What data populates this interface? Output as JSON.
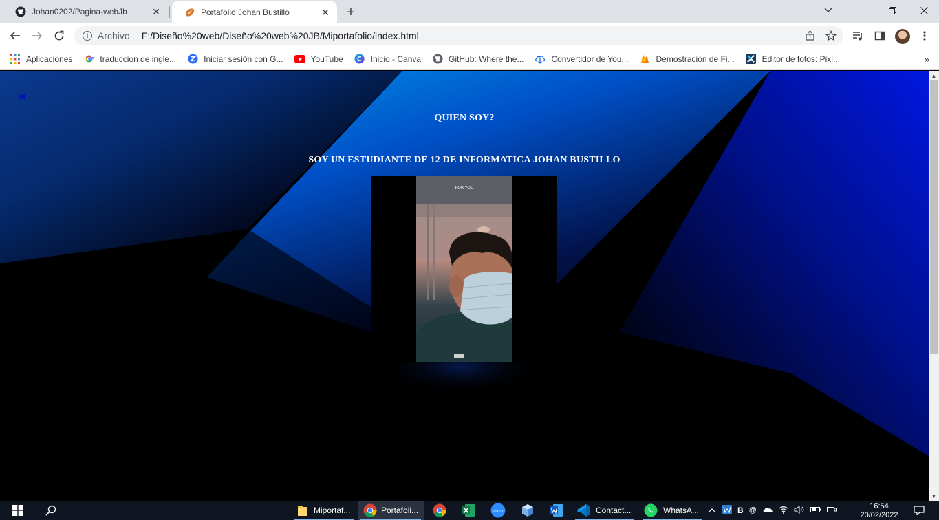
{
  "browser": {
    "tabs": [
      {
        "title": "Johan0202/Pagina-webJb",
        "icon": "github-icon",
        "active": false
      },
      {
        "title": "Portafolio Johan Bustillo",
        "icon": "football-icon",
        "active": true
      }
    ],
    "address": {
      "scheme_label": "Archivo",
      "url": "F:/Diseño%20web/Diseño%20web%20JB/Miportafolio/index.html"
    },
    "bookmarks": [
      {
        "label": "Aplicaciones",
        "icon": "apps-grid-icon"
      },
      {
        "label": "traduccion de ingle...",
        "icon": "google-icon"
      },
      {
        "label": "Iniciar sesión con G...",
        "icon": "zoho-icon"
      },
      {
        "label": "YouTube",
        "icon": "youtube-icon"
      },
      {
        "label": "Inicio - Canva",
        "icon": "canva-icon"
      },
      {
        "label": "GitHub: Where the...",
        "icon": "github-icon"
      },
      {
        "label": "Convertidor de You...",
        "icon": "download-cloud-icon"
      },
      {
        "label": "Demostración de Fi...",
        "icon": "firebase-icon"
      },
      {
        "label": "Editor de fotos: Pixl...",
        "icon": "pixlr-icon"
      }
    ]
  },
  "page": {
    "menu_icon": "≡",
    "heading": "QUIEN SOY?",
    "subheading": "SOY UN ESTUDIANTE DE 12 DE INFORMATICA JOHAN BUSTILLO",
    "photo_caption": "FOR YOU"
  },
  "taskbar": {
    "items": [
      {
        "label": "Miportaf...",
        "icon": "folder-icon"
      },
      {
        "label": "Portafoli...",
        "icon": "chrome-icon",
        "active": true
      },
      {
        "label": "",
        "icon": "chrome-icon"
      },
      {
        "label": "",
        "icon": "excel-icon"
      },
      {
        "label": "",
        "icon": "zoom-icon"
      },
      {
        "label": "",
        "icon": "box-3d-icon"
      },
      {
        "label": "",
        "icon": "word-icon"
      },
      {
        "label": "Contact...",
        "icon": "vscode-icon"
      },
      {
        "label": "WhatsA...",
        "icon": "whatsapp-icon"
      }
    ],
    "clock_time": "16:54",
    "clock_date": "20/02/2022"
  },
  "colors": {
    "tabstrip": "#dee1e6",
    "page_bg": "#000000",
    "accent_blue": "#0044cc",
    "taskbar": "#101621"
  }
}
